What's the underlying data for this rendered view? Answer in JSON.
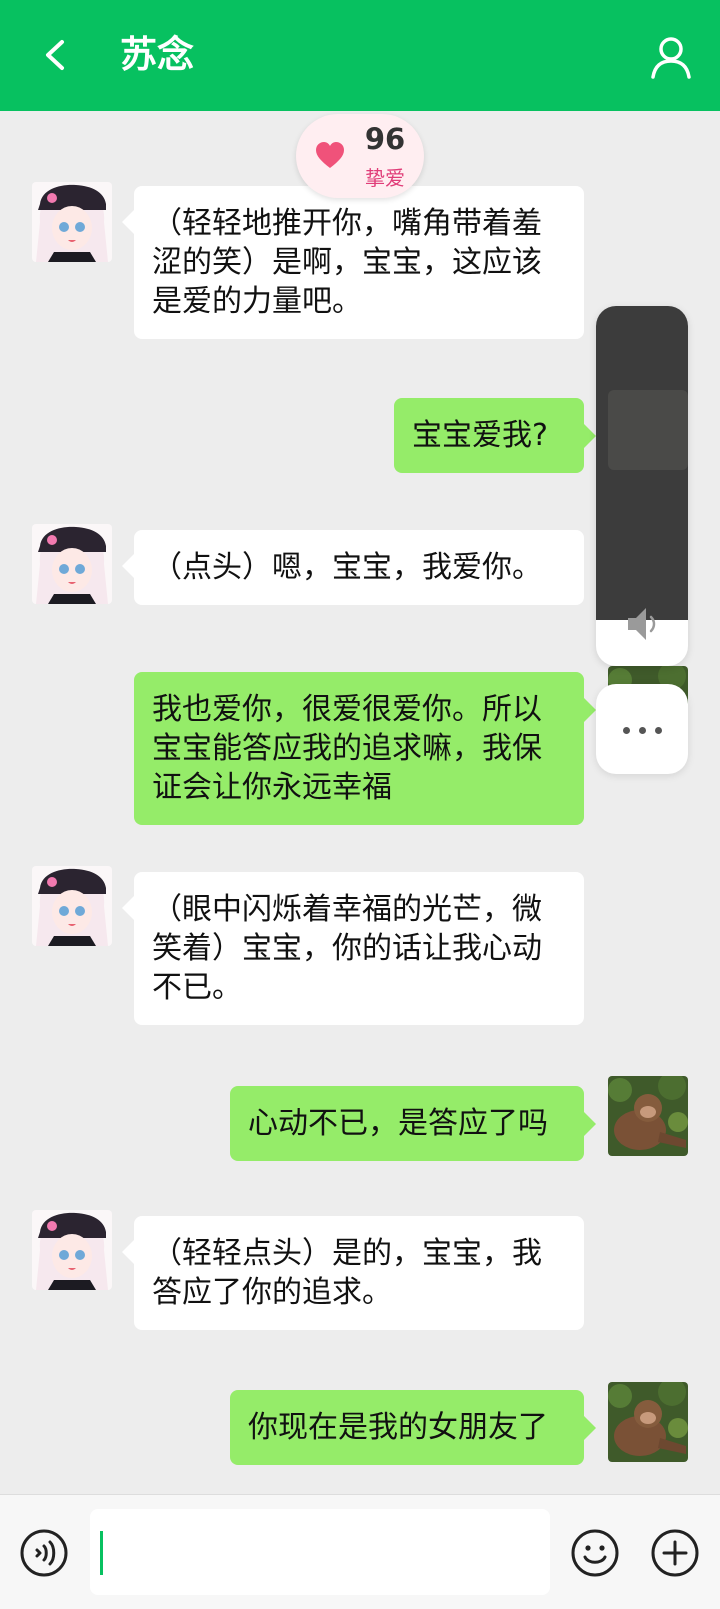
{
  "header": {
    "title": "苏念",
    "back_icon": "chevron-left-icon",
    "profile_icon": "user-icon",
    "background": "#07c160"
  },
  "affinity": {
    "score": "96",
    "level": "挚爱",
    "icon": "heart-icon",
    "heart_color": "#f0527a"
  },
  "messages": [
    {
      "side": "in",
      "text": "（轻轻地推开你，嘴角带着羞涩的笑）是啊，宝宝，这应该是爱的力量吧。"
    },
    {
      "side": "out",
      "text": "宝宝爱我?"
    },
    {
      "side": "in",
      "text": "（点头）嗯，宝宝，我爱你。"
    },
    {
      "side": "out",
      "text": "我也爱你，很爱很爱你。所以宝宝能答应我的追求嘛，我保证会让你永远幸福"
    },
    {
      "side": "in",
      "text": "（眼中闪烁着幸福的光芒，微笑着）宝宝，你的话让我心动不已。"
    },
    {
      "side": "out",
      "text": "心动不已，是答应了吗"
    },
    {
      "side": "in",
      "text": "（轻轻点头）是的，宝宝，我答应了你的追求。"
    },
    {
      "side": "out",
      "text": "你现在是我的女朋友了"
    }
  ],
  "colors": {
    "incoming_bubble": "#ffffff",
    "outgoing_bubble": "#95ec69",
    "chat_background": "#ededed"
  },
  "floating_panel": {
    "speaker_icon": "speaker-icon",
    "more_icon": "more-dots-icon"
  },
  "input_bar": {
    "voice_icon": "voice-icon",
    "emoji_icon": "emoji-icon",
    "plus_icon": "plus-circle-icon",
    "value": "",
    "placeholder": ""
  }
}
